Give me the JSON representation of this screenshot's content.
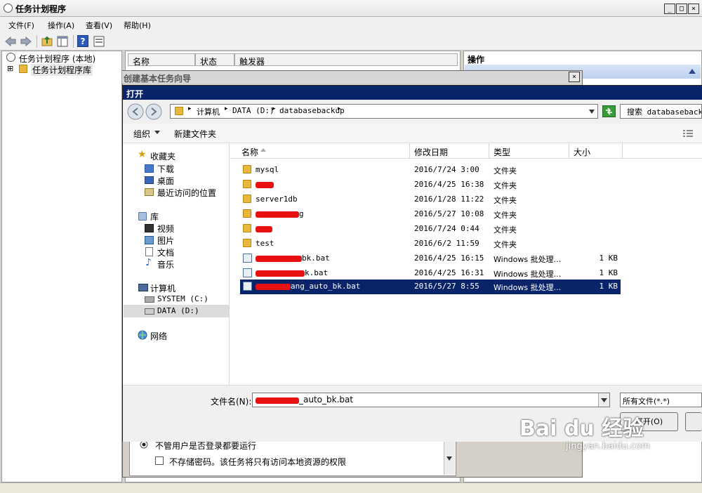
{
  "main_window": {
    "title": "任务计划程序",
    "menu": [
      "文件(F)",
      "操作(A)",
      "查看(V)",
      "帮助(H)"
    ],
    "win_buttons": [
      "_",
      "□",
      "×"
    ],
    "tree": [
      "任务计划程序 (本地)",
      "任务计划程序库"
    ],
    "tree_expander": "⊞",
    "center_columns": [
      "名称",
      "状态",
      "触发器"
    ],
    "actions_header": "操作"
  },
  "wizard": {
    "title": "创建基本任务向导",
    "close_label": "×",
    "option_run": "不管用户是否登录都要运行",
    "option_nopass": "不存储密码。该任务将只有访问本地资源的权限"
  },
  "open_dialog": {
    "title": "打开",
    "breadcrumb": [
      "计算机",
      "DATA (D:)",
      "databasebackup"
    ],
    "search_placeholder": "搜索 databasebackup",
    "toolbar": {
      "organize": "组织",
      "new_folder": "新建文件夹"
    },
    "nav": {
      "favorites": "收藏夹",
      "favorites_items": [
        "下载",
        "桌面",
        "最近访问的位置"
      ],
      "libraries": "库",
      "libraries_items": [
        "视频",
        "图片",
        "文档",
        "音乐"
      ],
      "computer": "计算机",
      "computer_items": [
        "SYSTEM (C:)",
        "DATA (D:)"
      ],
      "network": "网络"
    },
    "columns": [
      "名称",
      "修改日期",
      "类型",
      "大小"
    ],
    "files": [
      {
        "name": "mysql",
        "date": "2016/7/24 3:00",
        "type": "文件夹",
        "size": ""
      },
      {
        "name": "",
        "date": "2016/4/25 16:38",
        "type": "文件夹",
        "size": ""
      },
      {
        "name": "server1db",
        "date": "2016/1/28 11:22",
        "type": "文件夹",
        "size": ""
      },
      {
        "name": "g",
        "date": "2016/5/27 10:08",
        "type": "文件夹",
        "size": ""
      },
      {
        "name": "",
        "date": "2016/7/24 0:44",
        "type": "文件夹",
        "size": ""
      },
      {
        "name": "test",
        "date": "2016/6/2 11:59",
        "type": "文件夹",
        "size": ""
      },
      {
        "name": "bk.bat",
        "date": "2016/4/25 16:15",
        "type": "Windows 批处理...",
        "size": "1 KB"
      },
      {
        "name": "k.bat",
        "date": "2016/4/25 16:31",
        "type": "Windows 批处理...",
        "size": "1 KB"
      },
      {
        "name": "ang_auto_bk.bat",
        "date": "2016/5/27 8:55",
        "type": "Windows 批处理...",
        "size": "1 KB"
      }
    ],
    "filename_label": "文件名(N):",
    "filename_value": "_auto_bk.bat",
    "filetype_value": "所有文件(*.*)",
    "open_button": "打开(O)"
  },
  "watermark": {
    "brand": "Bai du 经验",
    "url": "jingyan.baidu.com"
  },
  "colors": {
    "selection": "#0a246a",
    "redaction": "#e81010",
    "folder": "#e8b83c"
  }
}
